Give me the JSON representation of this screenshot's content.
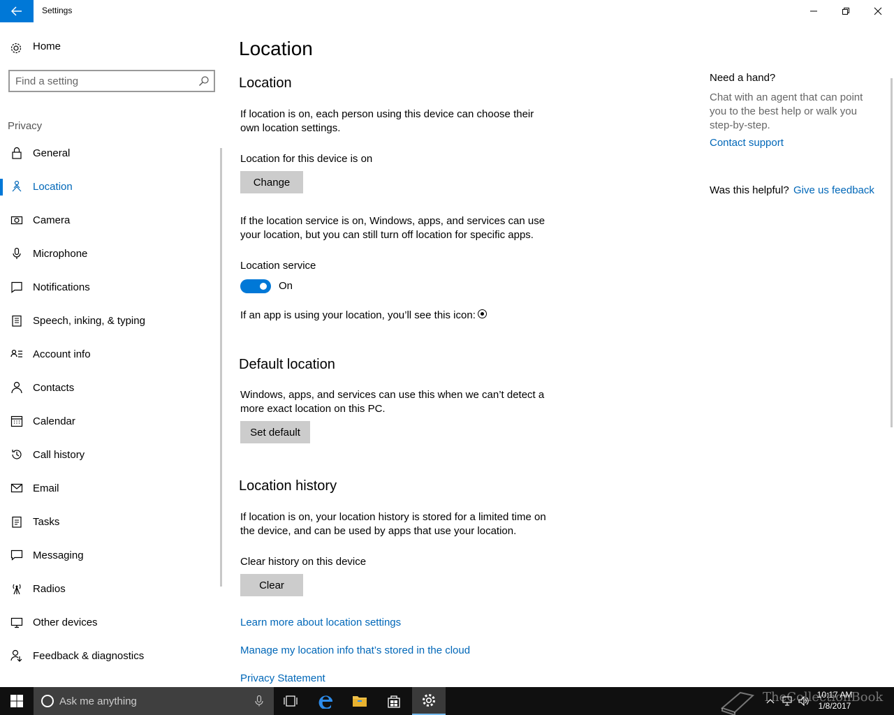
{
  "window": {
    "title": "Settings"
  },
  "sidebar": {
    "home_label": "Home",
    "search_placeholder": "Find a setting",
    "section_label": "Privacy",
    "items": [
      {
        "label": "General",
        "icon": "lock-icon"
      },
      {
        "label": "Location",
        "icon": "location-person-icon",
        "active": true
      },
      {
        "label": "Camera",
        "icon": "camera-icon"
      },
      {
        "label": "Microphone",
        "icon": "microphone-icon"
      },
      {
        "label": "Notifications",
        "icon": "notifications-icon"
      },
      {
        "label": "Speech, inking, & typing",
        "icon": "clipboard-icon"
      },
      {
        "label": "Account info",
        "icon": "account-info-icon"
      },
      {
        "label": "Contacts",
        "icon": "contacts-icon"
      },
      {
        "label": "Calendar",
        "icon": "calendar-icon"
      },
      {
        "label": "Call history",
        "icon": "history-icon"
      },
      {
        "label": "Email",
        "icon": "email-icon"
      },
      {
        "label": "Tasks",
        "icon": "tasks-icon"
      },
      {
        "label": "Messaging",
        "icon": "messaging-icon"
      },
      {
        "label": "Radios",
        "icon": "radio-antenna-icon"
      },
      {
        "label": "Other devices",
        "icon": "other-devices-icon"
      },
      {
        "label": "Feedback & diagnostics",
        "icon": "feedback-icon"
      }
    ]
  },
  "main": {
    "page_title": "Location",
    "location_heading": "Location",
    "location_desc": "If location is on, each person using this device can choose their own location settings.",
    "device_status": "Location for this device is on",
    "change_button": "Change",
    "service_desc": "If the location service is on, Windows, apps, and services can use your location, but you can still turn off location for specific apps.",
    "service_label": "Location service",
    "service_state": "On",
    "icon_note": "If an app is using your location, you’ll see this icon:",
    "default_heading": "Default location",
    "default_desc": "Windows, apps, and services can use this when we can’t detect a more exact location on this PC.",
    "set_default_button": "Set default",
    "history_heading": "Location history",
    "history_desc": "If location is on, your location history is stored for a limited time on the device, and can be used by apps that use your location.",
    "clear_label": "Clear history on this device",
    "clear_button": "Clear",
    "link_learn": "Learn more about location settings",
    "link_manage": "Manage my location info that’s stored in the cloud",
    "link_privacy": "Privacy Statement"
  },
  "help": {
    "heading": "Need a hand?",
    "desc": "Chat with an agent that can point you to the best help or walk you step-by-step.",
    "contact": "Contact support",
    "helpful": "Was this helpful?",
    "feedback": "Give us feedback"
  },
  "taskbar": {
    "search_text": "Ask me anything",
    "time": "10:17 AM",
    "date": "1/8/2017",
    "watermark": "TheCollectionBook"
  },
  "colors": {
    "accent": "#0078d7",
    "link": "#0067b8",
    "taskbar": "#101010"
  }
}
